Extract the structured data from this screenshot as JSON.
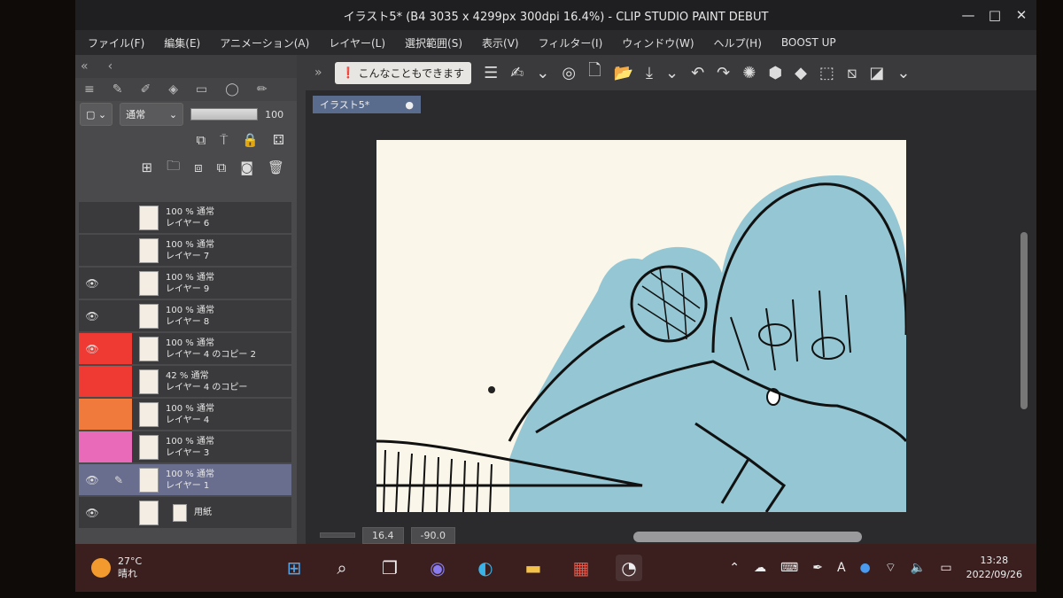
{
  "window": {
    "title": "イラスト5* (B4 3035 x 4299px 300dpi 16.4%) - CLIP STUDIO PAINT DEBUT",
    "controls": [
      "—",
      "□",
      "✕"
    ]
  },
  "menu": [
    "ファイル(F)",
    "編集(E)",
    "アニメーション(A)",
    "レイヤー(L)",
    "選択範囲(S)",
    "表示(V)",
    "フィルター(I)",
    "ウィンドウ(W)",
    "ヘルプ(H)",
    "BOOST UP"
  ],
  "toolbar": {
    "tip_label": "こんなこともできます"
  },
  "document_tab": "イラスト5*",
  "layer_panel": {
    "blend_mode": "通常",
    "opacity": "100",
    "layers": [
      {
        "info": "100 % 通常",
        "name": "レイヤー 6",
        "visible": false,
        "color": ""
      },
      {
        "info": "100 % 通常",
        "name": "レイヤー 7",
        "visible": false,
        "color": ""
      },
      {
        "info": "100 % 通常",
        "name": "レイヤー 9",
        "visible": true,
        "color": ""
      },
      {
        "info": "100 % 通常",
        "name": "レイヤー 8",
        "visible": true,
        "color": ""
      },
      {
        "info": "100 % 通常",
        "name": "レイヤー 4 のコピー 2",
        "visible": true,
        "color": "#ee3a33"
      },
      {
        "info": "42 % 通常",
        "name": "レイヤー 4 のコピー",
        "visible": false,
        "color": "#ee3a33"
      },
      {
        "info": "100 % 通常",
        "name": "レイヤー 4",
        "visible": false,
        "color": "#f07a3c"
      },
      {
        "info": "100 % 通常",
        "name": "レイヤー 3",
        "visible": false,
        "color": "#e86ab9"
      },
      {
        "info": "100 % 通常",
        "name": "レイヤー 1",
        "visible": true,
        "color": "",
        "selected": true
      }
    ],
    "paper_label": "用紙"
  },
  "status": {
    "zoom": "16.4",
    "rotation": "-90.0"
  },
  "taskbar": {
    "temperature": "27°C",
    "weather": "晴れ",
    "time": "13:28",
    "date": "2022/09/26",
    "ime": "A"
  },
  "colors": {
    "fill_blue": "#8ec4d2",
    "accent_tab": "#5a6c8e"
  }
}
